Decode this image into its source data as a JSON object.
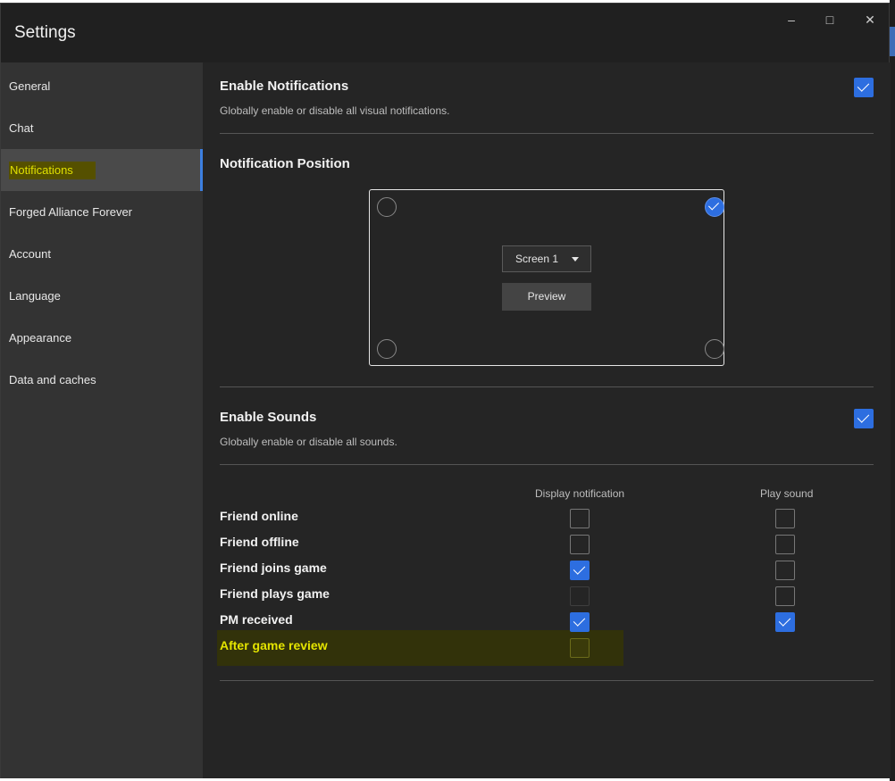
{
  "window": {
    "title": "Settings",
    "controls": [
      "minimize",
      "maximize",
      "close"
    ]
  },
  "sidebar": {
    "items": [
      {
        "label": "General",
        "active": false
      },
      {
        "label": "Chat",
        "active": false
      },
      {
        "label": "Notifications",
        "active": true
      },
      {
        "label": "Forged Alliance Forever",
        "active": false
      },
      {
        "label": "Account",
        "active": false
      },
      {
        "label": "Language",
        "active": false
      },
      {
        "label": "Appearance",
        "active": false
      },
      {
        "label": "Data and caches",
        "active": false
      }
    ]
  },
  "notifications": {
    "title": "Enable Notifications",
    "description": "Globally enable or disable all visual notifications.",
    "enabled": true
  },
  "position": {
    "title": "Notification Position",
    "selected_corner": "top-right",
    "screen_select": "Screen 1",
    "preview_label": "Preview"
  },
  "sounds": {
    "title": "Enable Sounds",
    "description": "Globally enable or disable all sounds.",
    "enabled": true
  },
  "table": {
    "col_display": "Display notification",
    "col_sound": "Play sound",
    "rows": [
      {
        "label": "Friend online",
        "display": false,
        "sound": false
      },
      {
        "label": "Friend offline",
        "display": false,
        "sound": false
      },
      {
        "label": "Friend joins game",
        "display": true,
        "sound": false
      },
      {
        "label": "Friend plays game",
        "display": false,
        "sound": false
      },
      {
        "label": "PM received",
        "display": true,
        "sound": true
      },
      {
        "label": "After game review",
        "display": false,
        "sound": null
      }
    ]
  },
  "colors": {
    "accent": "#2d6ee0",
    "highlight_text": "#e4e400",
    "highlight_bg": "#555000"
  }
}
